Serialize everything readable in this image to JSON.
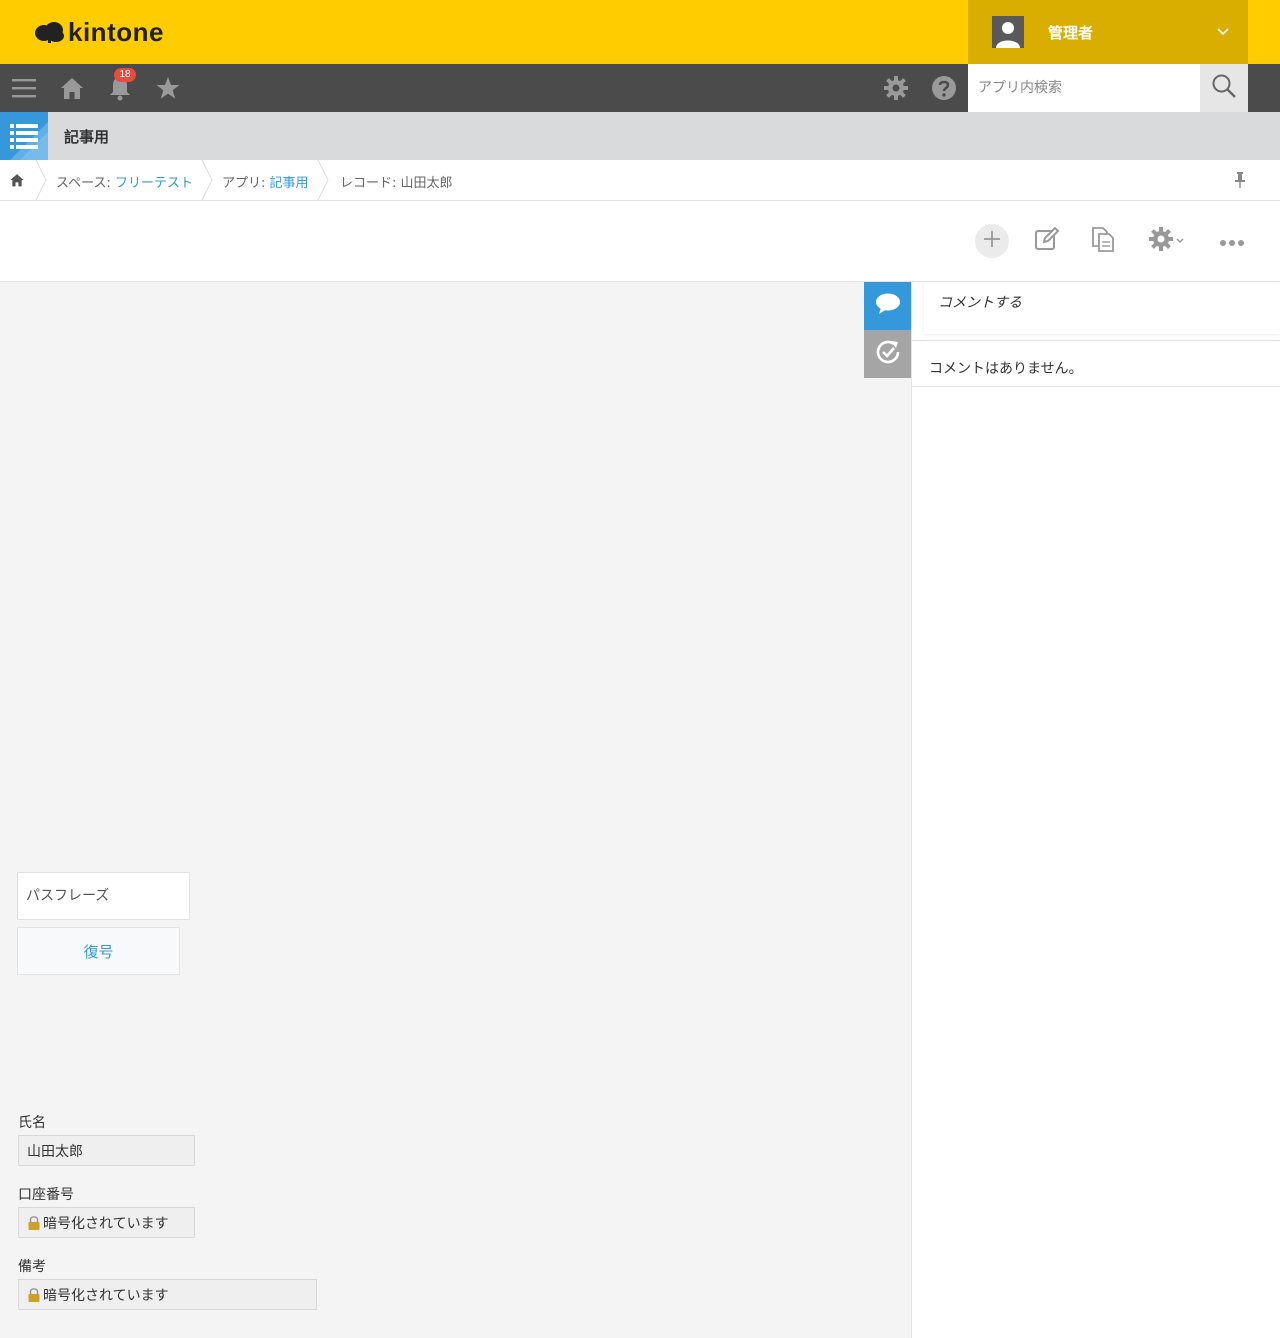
{
  "header": {
    "logo_text": "kintone",
    "user_name": "管理者",
    "brand_color": "#ffcc00"
  },
  "nav": {
    "notification_count": "18",
    "search_placeholder": "アプリ内検索",
    "icons": [
      "menu-icon",
      "home-icon",
      "bell-icon",
      "star-icon",
      "gear-icon",
      "help-icon",
      "search-icon"
    ]
  },
  "app": {
    "title": "記事用"
  },
  "breadcrumb": {
    "space_label": "スペース: ",
    "space_name": "フリーテスト",
    "app_label": "アプリ: ",
    "app_name": "記事用",
    "record_label": "レコード: 山田太郎"
  },
  "comments": {
    "input_placeholder": "コメントする",
    "empty_text": "コメントはありません。"
  },
  "decrypt": {
    "passphrase_placeholder": "パスフレーズ",
    "button_label": "復号"
  },
  "fields": {
    "name_label": "氏名",
    "name_value": "山田太郎",
    "account_label": "口座番号",
    "account_value": "暗号化されています",
    "notes_label": "備考",
    "notes_value": "暗号化されています"
  }
}
